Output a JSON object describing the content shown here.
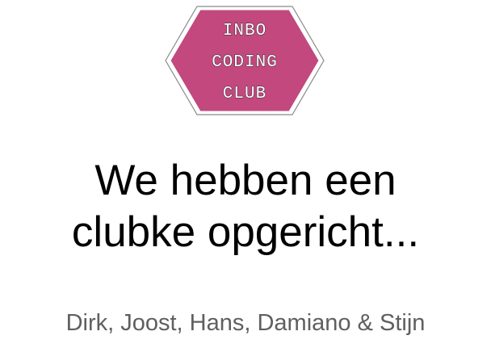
{
  "logo": {
    "line1": "INBO",
    "line2": "CODING",
    "line3": "CLUB",
    "fill_color": "#c2487e",
    "border_color": "#7a7a7a"
  },
  "title": {
    "line1": "We hebben een",
    "line2": "clubke opgericht..."
  },
  "subtitle": "Dirk, Joost, Hans, Damiano & Stijn"
}
